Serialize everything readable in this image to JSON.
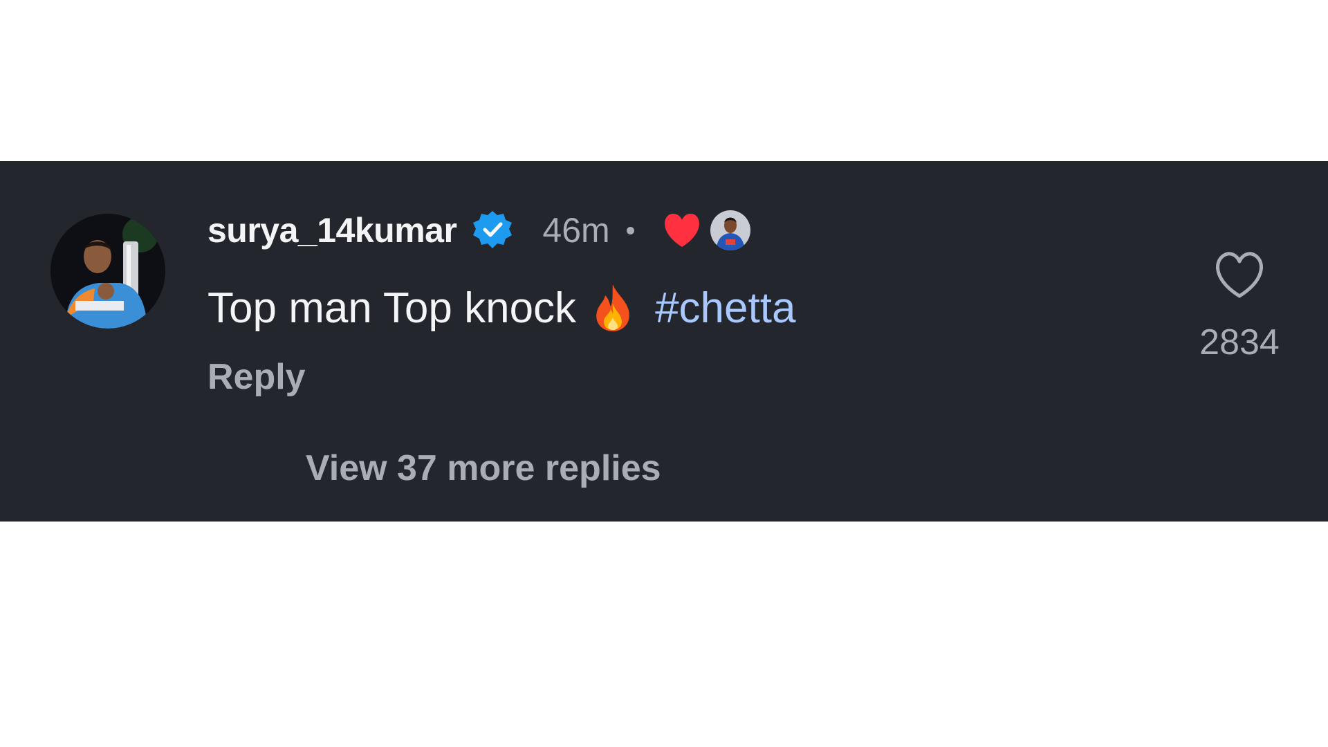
{
  "comment": {
    "username": "surya_14kumar",
    "verified": true,
    "timestamp": "46m",
    "text": "Top man Top knock",
    "emoji": "🔥",
    "hashtag": "#chetta",
    "reply_label": "Reply",
    "view_replies_label": "View 37 more replies",
    "like_count": "2834",
    "liked_by_creator": true,
    "icons": {
      "avatar": "user-avatar",
      "verified": "verified-badge-icon",
      "liked_by_creator": "heart-icon",
      "creator_avatar": "creator-avatar",
      "emoji": "fire-icon",
      "like_button": "heart-outline-icon"
    }
  },
  "colors": {
    "background": "#24262d",
    "primary_text": "#f3f4f6",
    "secondary_text": "#a9adb5",
    "hashtag": "#a8c8ff",
    "verified_badge": "#1d9bf0",
    "heart": "#ff3040"
  }
}
